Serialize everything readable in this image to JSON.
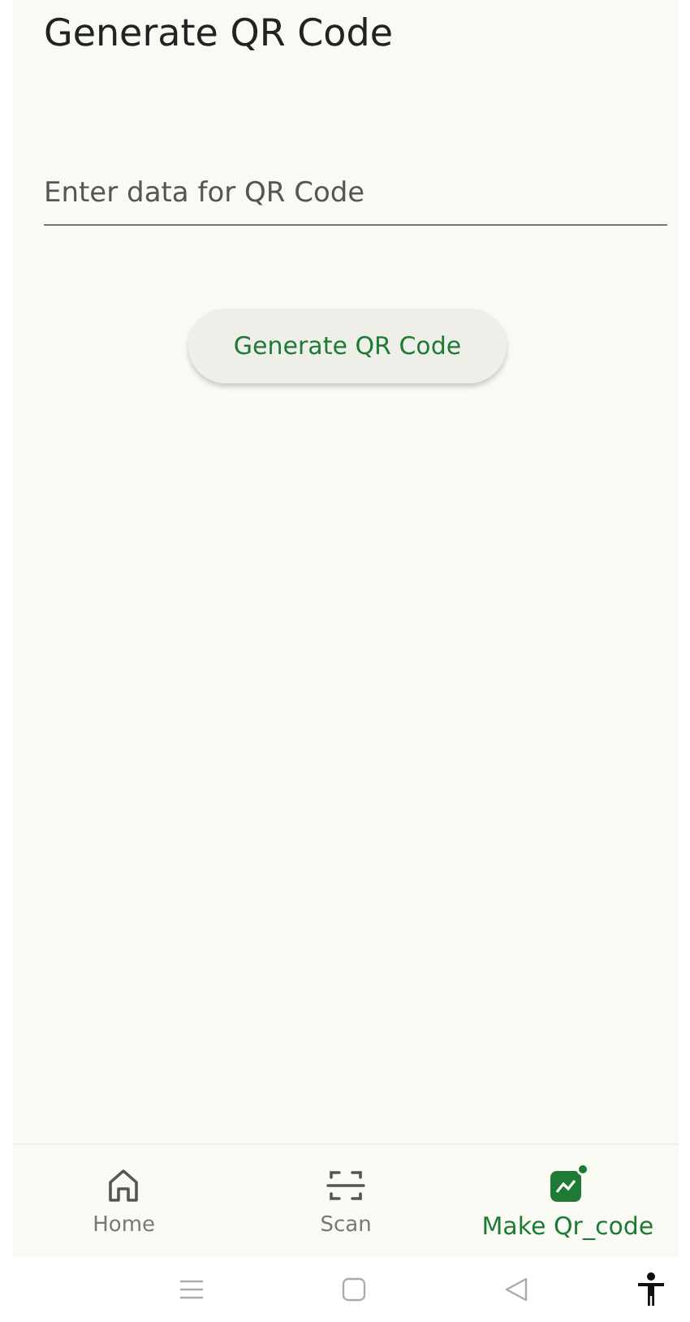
{
  "title": "Generate QR Code",
  "input": {
    "placeholder": "Enter data for QR Code"
  },
  "button": "Generate QR Code",
  "nav": [
    {
      "label": "Home",
      "kind": "home",
      "selected": false
    },
    {
      "label": "Scan",
      "kind": "scan",
      "selected": false
    },
    {
      "label": "Make Qr_code",
      "kind": "make",
      "selected": true
    }
  ],
  "system_bar": [
    {
      "kind": "menu"
    },
    {
      "kind": "home"
    },
    {
      "kind": "back"
    },
    {
      "kind": "accessibility"
    }
  ]
}
